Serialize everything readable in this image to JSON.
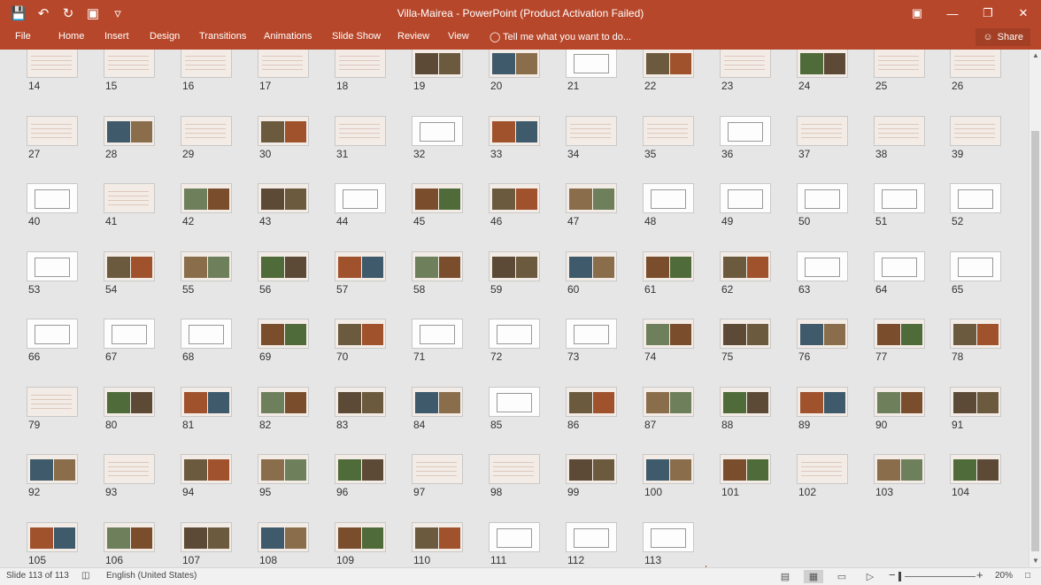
{
  "window": {
    "title": "Villa-Mairea - PowerPoint (Product Activation Failed)"
  },
  "qat": [
    "save-icon",
    "undo-icon",
    "redo-icon",
    "present-icon",
    "customize-icon"
  ],
  "ribbon": {
    "tabs": [
      "File",
      "Home",
      "Insert",
      "Design",
      "Transitions",
      "Animations",
      "Slide Show",
      "Review",
      "View"
    ],
    "tell_me": "Tell me what you want to do...",
    "share": "Share"
  },
  "slides": {
    "numbers": [
      14,
      15,
      16,
      17,
      18,
      19,
      20,
      21,
      22,
      23,
      24,
      25,
      26,
      27,
      28,
      29,
      30,
      31,
      32,
      33,
      34,
      35,
      36,
      37,
      38,
      39,
      40,
      41,
      42,
      43,
      44,
      45,
      46,
      47,
      48,
      49,
      50,
      51,
      52,
      53,
      54,
      55,
      56,
      57,
      58,
      59,
      60,
      61,
      62,
      63,
      64,
      65,
      66,
      67,
      68,
      69,
      70,
      71,
      72,
      73,
      74,
      75,
      76,
      77,
      78,
      79,
      80,
      81,
      82,
      83,
      84,
      85,
      86,
      87,
      88,
      89,
      90,
      91,
      92,
      93,
      94,
      95,
      96,
      97,
      98,
      99,
      100,
      101,
      102,
      103,
      104,
      105,
      106,
      107,
      108,
      109,
      110,
      111,
      112,
      113
    ],
    "kinds": [
      "t",
      "t",
      "t",
      "t",
      "t",
      "m",
      "m",
      "w",
      "m",
      "t",
      "m",
      "t",
      "t",
      "t",
      "m",
      "t",
      "m",
      "t",
      "w",
      "m",
      "t",
      "t",
      "w",
      "t",
      "t",
      "t",
      "w",
      "t",
      "m",
      "m",
      "w",
      "m",
      "m",
      "m",
      "w",
      "w",
      "w",
      "w",
      "w",
      "w",
      "m",
      "m",
      "m",
      "m",
      "m",
      "m",
      "m",
      "m",
      "m",
      "w",
      "w",
      "w",
      "w",
      "w",
      "w",
      "m",
      "m",
      "w",
      "w",
      "w",
      "m",
      "m",
      "m",
      "m",
      "m",
      "t",
      "m",
      "m",
      "m",
      "m",
      "m",
      "w",
      "m",
      "m",
      "m",
      "m",
      "m",
      "m",
      "m",
      "t",
      "m",
      "m",
      "m",
      "t",
      "t",
      "m",
      "m",
      "m",
      "t",
      "m",
      "m",
      "m",
      "m",
      "m",
      "m",
      "m",
      "m",
      "w",
      "w",
      "w"
    ]
  },
  "status": {
    "slide": "Slide 113 of 113",
    "language": "English (United States)",
    "zoom": "20%"
  }
}
